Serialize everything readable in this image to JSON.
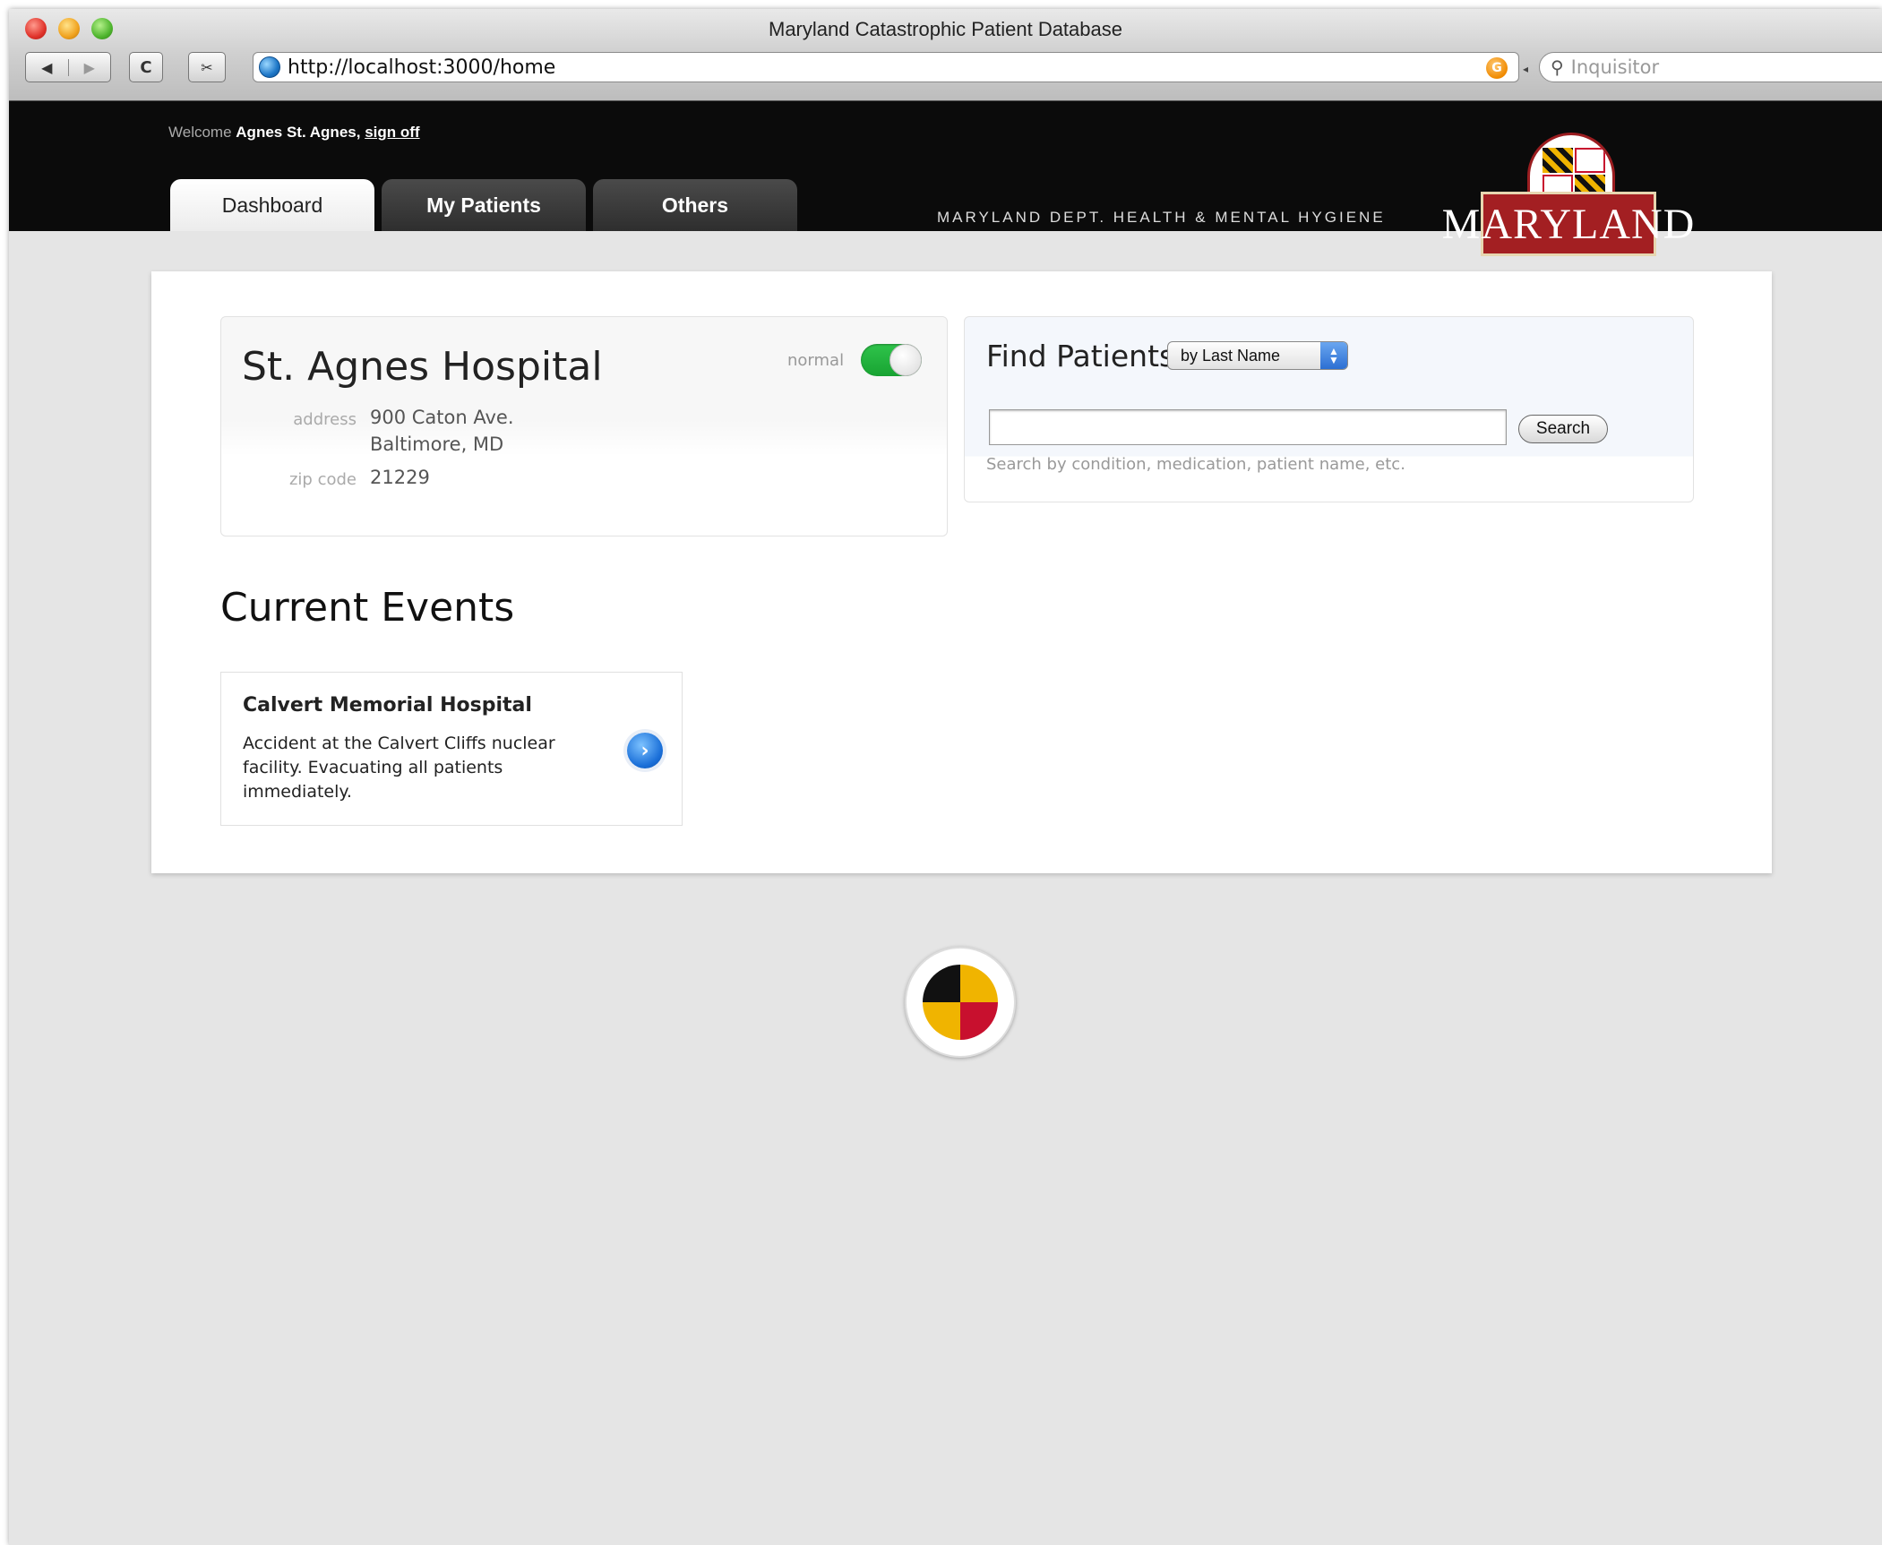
{
  "browser": {
    "window_title": "Maryland Catastrophic Patient Database",
    "url": "http://localhost:3000/home",
    "search_placeholder": "Inquisitor",
    "back_glyph": "◀",
    "forward_glyph": "▶",
    "reload_glyph": "C",
    "rss_glyph": "G"
  },
  "header": {
    "welcome_label": "Welcome",
    "user_name": "Agnes St. Agnes,",
    "sign_off": "sign off",
    "tabs": [
      {
        "label": "Dashboard",
        "active": true
      },
      {
        "label": "My Patients",
        "active": false
      },
      {
        "label": "Others",
        "active": false
      }
    ],
    "department": "MARYLAND DEPT. HEALTH & MENTAL HYGIENE",
    "logo_text": "MARYLAND"
  },
  "hospital": {
    "name": "St. Agnes Hospital",
    "status_label": "normal",
    "status_on": true,
    "address_label": "address",
    "address_line1": "900 Caton Ave.",
    "address_line2": "Baltimore, MD",
    "zip_label": "zip code",
    "zip": "21229"
  },
  "find_patients": {
    "title": "Find Patients",
    "filter_selected": "by Last Name",
    "search_value": "",
    "search_button": "Search",
    "hint": "Search by condition, medication, patient name, etc."
  },
  "events": {
    "title": "Current Events",
    "items": [
      {
        "hospital": "Calvert Memorial Hospital",
        "description": "Accident at the Calvert Cliffs nuclear facility. Evacuating all patients immediately."
      }
    ]
  },
  "colors": {
    "header_bg": "#0b0b0b",
    "toggle_on": "#18a332",
    "logo_red": "#a31f22",
    "page_bg": "#e5e5e5"
  },
  "icons": [
    "globe-icon",
    "rss-icon",
    "search-icon",
    "chevron-right-icon",
    "select-arrow-icon"
  ]
}
